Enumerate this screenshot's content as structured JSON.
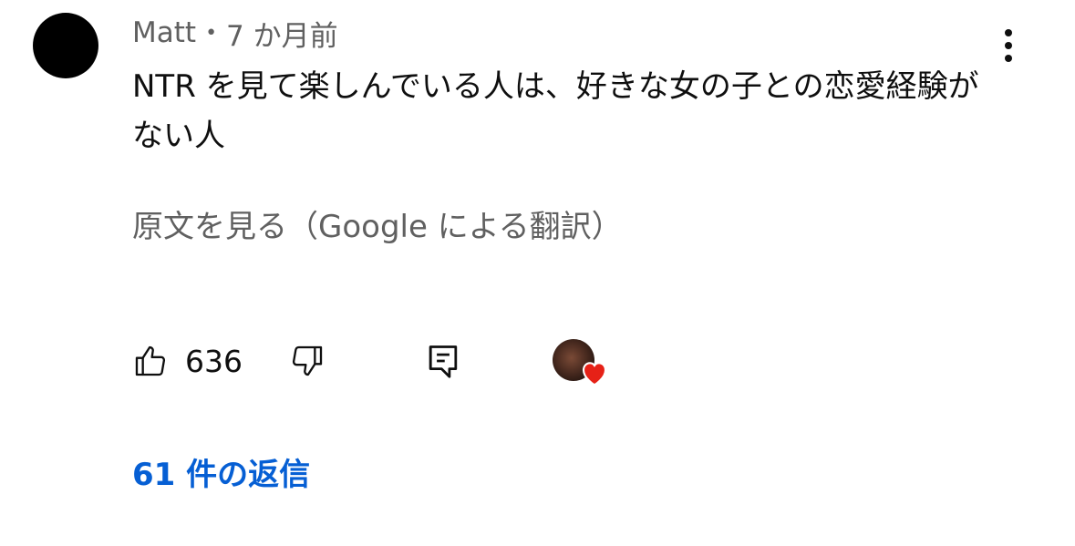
{
  "comment": {
    "author": "Matt",
    "separator": "•",
    "timestamp": "7 か月前",
    "text": "NTR を見て楽しんでいる人は、好きな女の子との恋愛経験がない人",
    "translate_label": "原文を見る（Google による翻訳）",
    "like_count": "636",
    "creator_hearted": true,
    "replies_label": "61 件の返信"
  },
  "icons": {
    "avatar": "avatar-icon",
    "more": "more-vert-icon",
    "like": "thumb-up-icon",
    "dislike": "thumb-down-icon",
    "reply": "reply-comment-icon",
    "heart": "heart-icon"
  },
  "colors": {
    "link_blue": "#065fd4",
    "secondary_text": "#606060",
    "heart_red": "#e62117"
  }
}
